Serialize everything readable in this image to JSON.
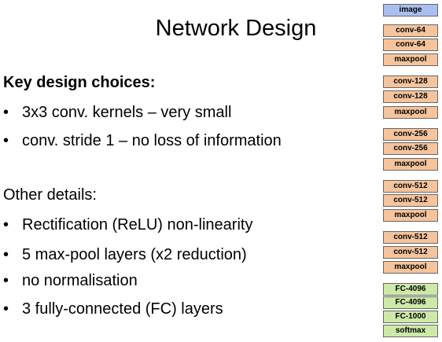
{
  "slide": {
    "title": "Network Design",
    "key_heading": "Key design choices:",
    "key_bullets": [
      "3x3 conv. kernels – very small",
      "conv. stride 1 – no loss of information"
    ],
    "other_heading": "Other details:",
    "other_bullets": [
      "Rectification (ReLU) non-linearity",
      "5 max-pool layers (x2 reduction)",
      "no normalisation",
      "3 fully-connected (FC) layers"
    ],
    "bullet_glyph": "•"
  },
  "network_diagram": {
    "colors": {
      "input": "#a9bff0",
      "conv": "#f5c49c",
      "fc": "#cde9a8"
    },
    "layers": [
      {
        "label": "image",
        "kind": "input"
      },
      {
        "label": "conv-64",
        "kind": "conv"
      },
      {
        "label": "conv-64",
        "kind": "conv"
      },
      {
        "label": "maxpool",
        "kind": "conv"
      },
      {
        "label": "conv-128",
        "kind": "conv"
      },
      {
        "label": "conv-128",
        "kind": "conv"
      },
      {
        "label": "maxpool",
        "kind": "conv"
      },
      {
        "label": "conv-256",
        "kind": "conv"
      },
      {
        "label": "conv-256",
        "kind": "conv"
      },
      {
        "label": "maxpool",
        "kind": "conv"
      },
      {
        "label": "conv-512",
        "kind": "conv"
      },
      {
        "label": "conv-512",
        "kind": "conv"
      },
      {
        "label": "maxpool",
        "kind": "conv"
      },
      {
        "label": "conv-512",
        "kind": "conv"
      },
      {
        "label": "conv-512",
        "kind": "conv"
      },
      {
        "label": "maxpool",
        "kind": "conv"
      },
      {
        "label": "FC-4096",
        "kind": "fc"
      },
      {
        "label": "FC-4096",
        "kind": "fc"
      },
      {
        "label": "FC-1000",
        "kind": "fc"
      },
      {
        "label": "softmax",
        "kind": "fc"
      }
    ]
  }
}
